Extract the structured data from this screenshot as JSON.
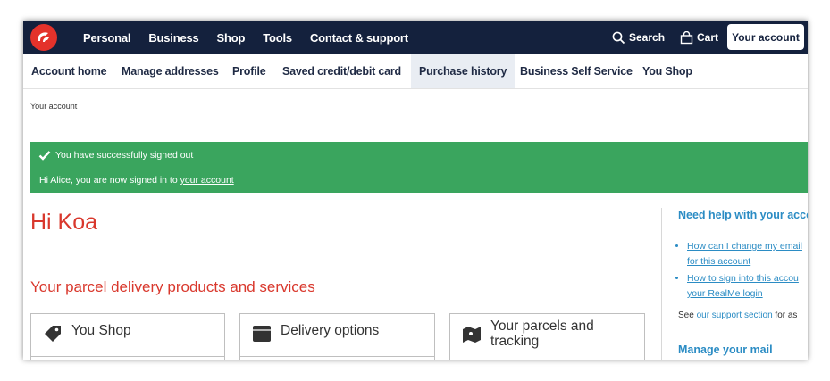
{
  "header": {
    "nav": [
      "Personal",
      "Business",
      "Shop",
      "Tools",
      "Contact & support"
    ],
    "search_label": "Search",
    "cart_label": "Cart",
    "account_button": "Your account"
  },
  "subnav": {
    "items": [
      "Account home",
      "Manage addresses",
      "Profile",
      "Saved credit/debit card",
      "Purchase history",
      "Business Self Service",
      "You Shop"
    ],
    "active": "Purchase history"
  },
  "breadcrumb": "Your account",
  "alert": {
    "line1": "You have successfully signed out",
    "line2_prefix": "Hi Alice, you are now signed in to ",
    "line2_link": "your account"
  },
  "greeting": "Hi Koa",
  "section_title": "Your parcel delivery products and services",
  "cards": [
    {
      "title": "You Shop",
      "icon": "tag-icon"
    },
    {
      "title": "Delivery options",
      "icon": "mailbox-icon"
    },
    {
      "title_line1": "Your parcels and",
      "title_line2": "tracking",
      "icon": "map-icon"
    }
  ],
  "sidebar": {
    "help_heading": "Need help with your acco",
    "links": [
      {
        "line1": "How can I change my email",
        "line2": "for this account"
      },
      {
        "line1": "How to sign into this accou",
        "line2": "your RealMe login"
      }
    ],
    "see_prefix": "See ",
    "see_link": "our support section",
    "see_suffix": " for as",
    "manage_heading": "Manage your mail"
  },
  "colors": {
    "nav_bg": "#14213d",
    "brand_red": "#e4322b",
    "heading_red": "#d9382d",
    "alert_green": "#3aa55e",
    "link_blue": "#2b8cc4"
  }
}
